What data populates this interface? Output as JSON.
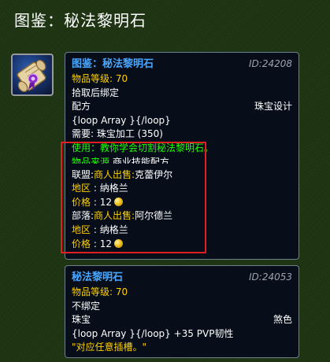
{
  "page_title": "图鉴：秘法黎明石",
  "icon": "scroll-recipe-icon",
  "colors": {
    "item_name": "#4aa6ff",
    "label_yellow": "#ffd100",
    "use_green": "#1eff00",
    "id_gray": "#9ca3ad",
    "highlight": "#e02020"
  },
  "recipe": {
    "name": "图鉴：秘法黎明石",
    "id": "ID:24208",
    "level_label": "物品等级:",
    "level_value": "70",
    "bind": "拾取后绑定",
    "type": "配方",
    "category": "珠宝设计",
    "template_text": "{loop Array }{/loop}",
    "requires": "需要: 珠宝加工 (350)",
    "use_text": "使用：教你学会切割秘法黎明石。",
    "source_label": "物品来源",
    "source_value": "商业技能配方"
  },
  "vendors": [
    {
      "faction": "联盟:",
      "seller_label": "商人出售:",
      "seller_name": "克蕾伊尔",
      "zone_label": "地区",
      "zone_value": "纳格兰",
      "price_label": "价格",
      "price_value": "12"
    },
    {
      "faction": "部落:",
      "seller_label": "商人出售:",
      "seller_name": "阿尔德兰",
      "zone_label": "地区",
      "zone_value": "纳格兰",
      "price_label": "价格",
      "price_value": "12"
    }
  ],
  "gem": {
    "name": "秘法黎明石",
    "id": "ID:24053",
    "level_label": "物品等级:",
    "level_value": "70",
    "bind": "不绑定",
    "type": "珠宝",
    "color": "煞色",
    "stats": "{loop Array }{/loop} +35 PVP韧性",
    "flavor": "\"对应任意插槽。\""
  }
}
